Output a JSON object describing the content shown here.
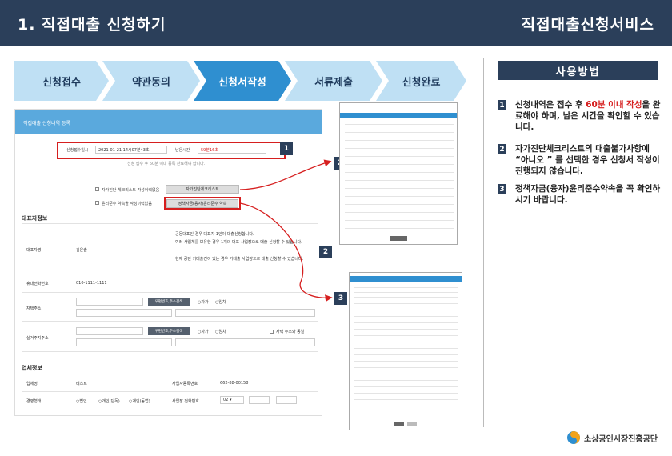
{
  "header": {
    "title": "1. 직접대출 신청하기",
    "service": "직접대출신청서비스"
  },
  "steps": [
    "신청접수",
    "약관동의",
    "신청서작성",
    "서류제출",
    "신청완료"
  ],
  "form": {
    "heading": "직접대출 신청내역 등록",
    "apply_label": "신청접수일시",
    "apply_value": "2021-01-21 14시07분43초",
    "remain_label": "남은시간",
    "remain_value": "59분16초",
    "note": "신청 접수 후 60분 이내 등록 완료해야 합니다.",
    "check1": "자가진단 체크리스트 작성이력없음",
    "check2": "윤리준수 약속을 작성이력없음",
    "btn_check": "자가진단체크리스트",
    "btn_ethic": "정책자금(융자)윤리준수 약속",
    "sec_rep": "대표자정보",
    "rep_name_label": "대표자명",
    "rep_name_value": "김은솔",
    "rep_notes": [
      "공동대표인 경우 대표자 1인이 대출신청합니다.",
      "여러 사업체를 보유한 경우 1개의 대표 사업장으로 대출 신청할 수 있습니다.",
      "현재 공단 기대출건이 있는 경우 기대출 사업장으로 대출 신청할 수 있습니다."
    ],
    "phone_label": "휴대전화번호",
    "phone_value": "010-1111-1111",
    "home_label": "자택주소",
    "zip_btn": "우편번호,주소검색",
    "own": "자가",
    "rent": "임차",
    "live_label": "실거주지주소",
    "same_addr": "자택 주소와 동일",
    "sec_biz": "업체정보",
    "biz_label": "업체명",
    "biz_value": "테스트",
    "bizno_label": "사업자등록번호",
    "bizno_value": "662-88-00158",
    "type_label": "경영형태",
    "type_options": [
      "법인",
      "개인(단독)",
      "개인(동업)"
    ],
    "tel_label": "사업장 전화번호",
    "tel_prefix": "02"
  },
  "tags": [
    "1",
    "2",
    "2",
    "3"
  ],
  "howto": {
    "title": "사용방법",
    "items": [
      {
        "num": "1",
        "pre": "신청내역은 접수 후 ",
        "highlight": "60분 이내 작성",
        "post": "을 완료해야 하며, 남은 시간을 확인할 수 있습니다."
      },
      {
        "num": "2",
        "pre": "자가진단체크리스트의 대출불가사항에 “아니오 ” 를 선택한 경우 신청서 작성이 진행되지 않습니다.",
        "highlight": "",
        "post": ""
      },
      {
        "num": "3",
        "pre": "정책자금(융자)윤리준수약속을 꼭 확인하시기 바랍니다.",
        "highlight": "",
        "post": ""
      }
    ]
  },
  "logo_text": "소상공인시장진흥공단",
  "colors": {
    "navy": "#2b3f5a",
    "accent": "#2f8fd0",
    "red": "#d61f1f",
    "step_idle": "#bfe0f4"
  }
}
